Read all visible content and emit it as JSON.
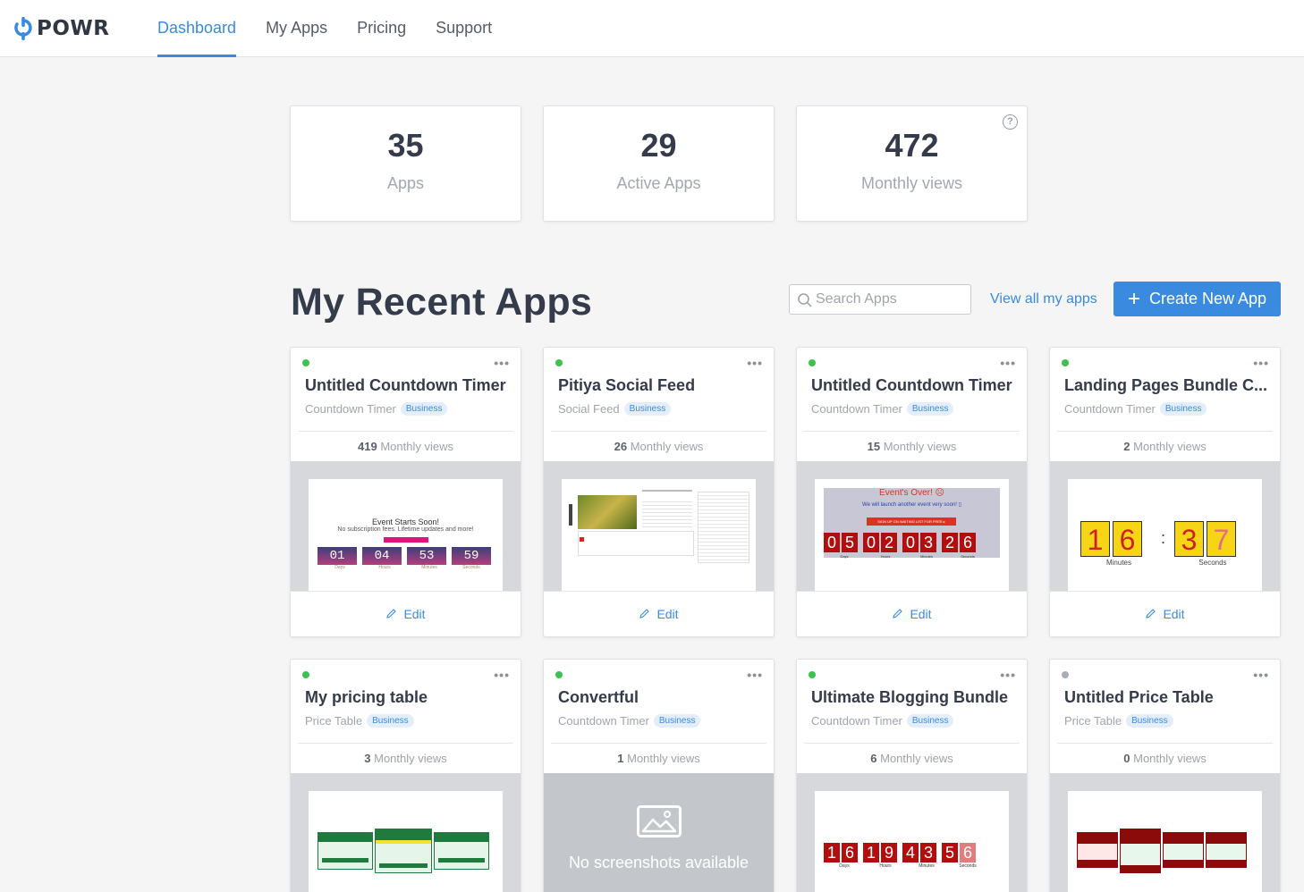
{
  "brand": {
    "name": "POWR"
  },
  "nav": {
    "items": [
      "Dashboard",
      "My Apps",
      "Pricing",
      "Support"
    ],
    "active": "Dashboard"
  },
  "stats": [
    {
      "value": "35",
      "label": "Apps"
    },
    {
      "value": "29",
      "label": "Active Apps"
    },
    {
      "value": "472",
      "label": "Monthly views",
      "help": "?"
    }
  ],
  "recent": {
    "title": "My Recent Apps",
    "search_placeholder": "Search Apps",
    "view_all": "View all my apps",
    "create": "Create New App",
    "create_icon": "+",
    "edit_label": "Edit",
    "menu": "•••",
    "views_suffix": "Monthly views",
    "no_screenshot": "No screenshots available"
  },
  "apps": [
    {
      "title": "Untitled Countdown Timer",
      "type": "Countdown Timer",
      "plan": "Business",
      "views": "419",
      "active": true
    },
    {
      "title": "Pitiya Social Feed",
      "type": "Social Feed",
      "plan": "Business",
      "views": "26",
      "active": true
    },
    {
      "title": "Untitled Countdown Timer",
      "type": "Countdown Timer",
      "plan": "Business",
      "views": "15",
      "active": true
    },
    {
      "title": "Landing Pages Bundle C...",
      "type": "Countdown Timer",
      "plan": "Business",
      "views": "2",
      "active": true
    },
    {
      "title": "My pricing table",
      "type": "Price Table",
      "plan": "Business",
      "views": "3",
      "active": true
    },
    {
      "title": "Convertful",
      "type": "Countdown Timer",
      "plan": "Business",
      "views": "1",
      "active": true
    },
    {
      "title": "Ultimate Blogging Bundle",
      "type": "Countdown Timer",
      "plan": "Business",
      "views": "6",
      "active": true
    },
    {
      "title": "Untitled Price Table",
      "type": "Price Table",
      "plan": "Business",
      "views": "0",
      "active": false
    }
  ],
  "thumbs": {
    "t1": {
      "heading": "Event Starts Soon!",
      "sub": "No subscription fees. Lifetime updates and more!",
      "digits": [
        "01",
        "04",
        "53",
        "59"
      ],
      "units": [
        "Days",
        "Hours",
        "Minutes",
        "Seconds"
      ]
    },
    "t3": {
      "heading": "Event's Over! ☹",
      "sub": "We will launch another event very soon! ▯",
      "cta": "SIGN UP ON WAITING LIST FOR FREE ▸",
      "digits": [
        "0",
        "5",
        "0",
        "2",
        "0",
        "3",
        "2",
        "6"
      ],
      "units": [
        "Days",
        "Hours",
        "Minutes",
        "Seconds"
      ]
    },
    "t4": {
      "digits": [
        "1",
        "6",
        "3",
        "7"
      ],
      "units": [
        "Minutes",
        "Seconds"
      ]
    },
    "t7": {
      "digits": [
        "1",
        "6",
        "1",
        "9",
        "4",
        "3",
        "5",
        "6"
      ],
      "units": [
        "Days",
        "Hours",
        "Minutes",
        "Seconds"
      ]
    }
  },
  "colors": {
    "accent": "#3a8be0",
    "active_dot": "#3ec24f",
    "inactive_dot": "#a9adb5",
    "badge_bg": "#e4eefb"
  }
}
